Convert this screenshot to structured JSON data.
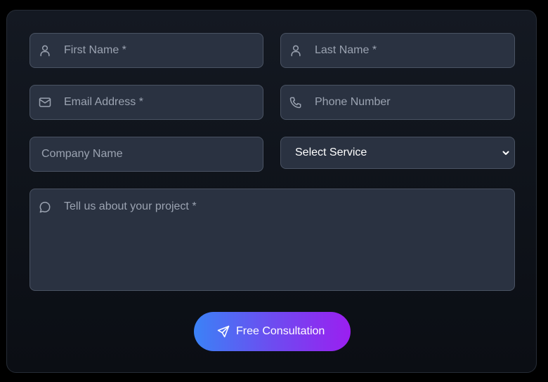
{
  "form": {
    "first_name": {
      "placeholder": "First Name *",
      "icon": "user-icon"
    },
    "last_name": {
      "placeholder": "Last Name *",
      "icon": "user-icon"
    },
    "email": {
      "placeholder": "Email Address *",
      "icon": "mail-icon"
    },
    "phone": {
      "placeholder": "Phone Number",
      "icon": "phone-icon"
    },
    "company": {
      "placeholder": "Company Name"
    },
    "service": {
      "selected": "Select Service",
      "icon": "chevron-down-icon"
    },
    "project": {
      "placeholder": "Tell us about your project *",
      "icon": "message-circle-icon"
    },
    "submit": {
      "label": "Free Consultation",
      "icon": "send-icon"
    }
  },
  "colors": {
    "field_background": "#2a3241",
    "field_border": "#4a5363",
    "placeholder_text": "#9ba3b1",
    "button_gradient_start": "#3b82f6",
    "button_gradient_end": "#9b1ff0"
  }
}
